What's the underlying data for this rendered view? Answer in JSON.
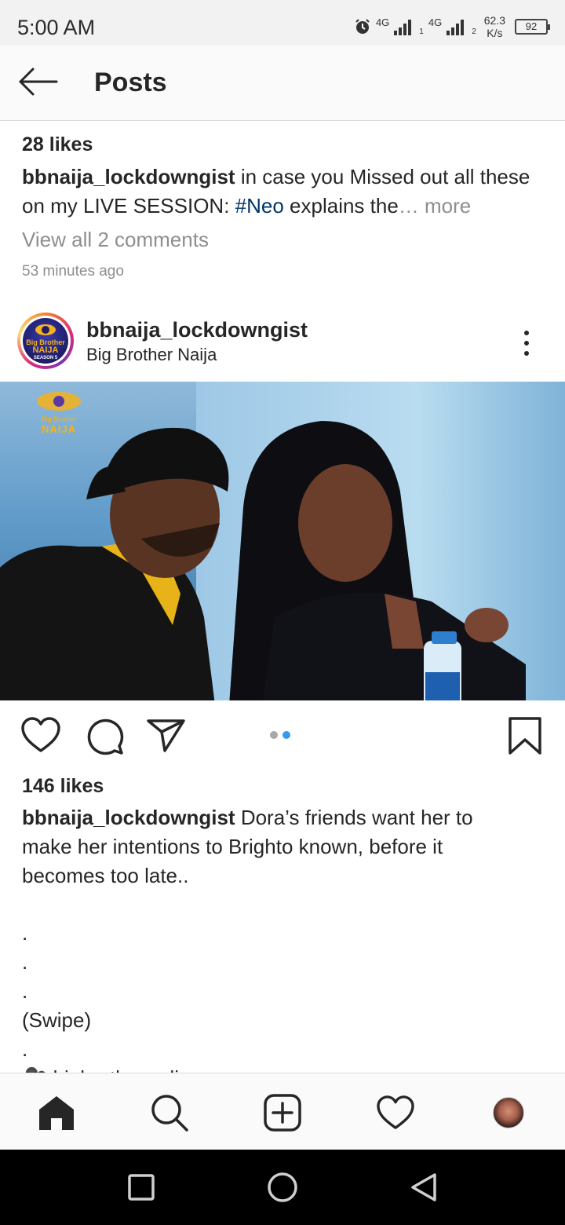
{
  "status_bar": {
    "time": "5:00 AM",
    "network_1": "4G",
    "network_2": "4G",
    "sim_1": "1",
    "sim_2": "2",
    "speed_value": "62.3",
    "speed_unit": "K/s",
    "battery": "92"
  },
  "header": {
    "title": "Posts"
  },
  "previous_post": {
    "likes": "28 likes",
    "caption_user": "bbnaija_lockdowngist",
    "caption_text_1": " in case you Missed out all these on my LIVE SESSION: ",
    "caption_hashtag": "#Neo",
    "caption_text_2": " explains the",
    "caption_more": "… more",
    "view_comments": "View all 2 comments",
    "time_ago": "53 minutes ago"
  },
  "post": {
    "username": "bbnaija_lockdowngist",
    "location": "Big Brother Naija",
    "avatar_text_1": "Big Brother",
    "avatar_text_2": "NAIJA",
    "avatar_text_3": "SEASON 5",
    "watermark_text_1": "Big Brother",
    "watermark_text_2": "NAIJA",
    "carousel_total": 2,
    "carousel_active": 2,
    "likes": "146 likes",
    "caption_user": "bbnaija_lockdowngist",
    "caption_line_1": " Dora’s friends want her to",
    "caption_line_2": "make her intentions to Brighto known, before it",
    "caption_line_3": "becomes too late..",
    "dot_1": ".",
    "dot_2": ".",
    "dot_3": ".",
    "swipe": "(Swipe)",
    "dot_4": ".",
    "cut_line": "🎥:bigbrotherradio"
  },
  "icons": {
    "back": "arrow-left-icon",
    "more": "more-vertical-icon",
    "like": "heart-icon",
    "comment": "comment-icon",
    "share": "send-icon",
    "save": "bookmark-icon",
    "home": "home-icon",
    "search": "search-icon",
    "add": "add-post-icon",
    "activity": "heart-icon"
  },
  "colors": {
    "hashtag": "#003569",
    "muted": "#8e8e8e",
    "active_dot": "#3897f0"
  }
}
